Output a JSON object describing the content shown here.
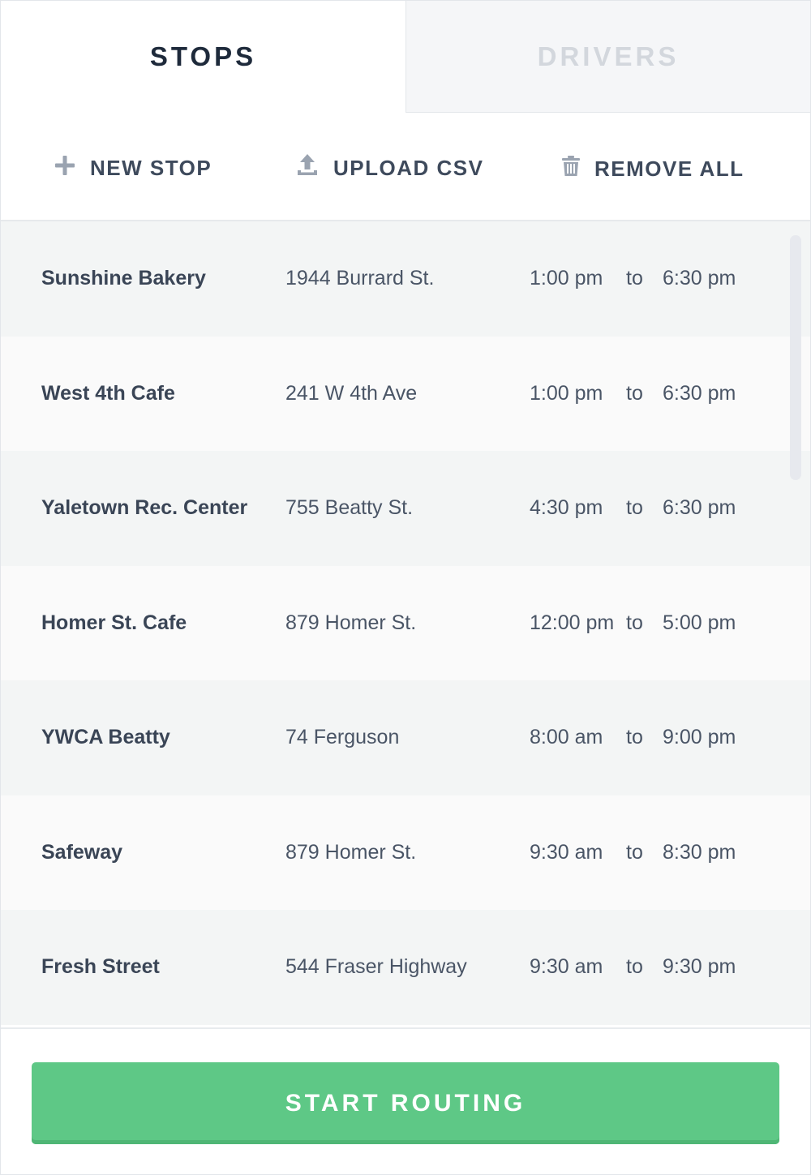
{
  "tabs": [
    {
      "label": "STOPS",
      "active": true
    },
    {
      "label": "DRIVERS",
      "active": false
    }
  ],
  "toolbar": {
    "new_stop": {
      "label": "NEW STOP",
      "icon": "plus-icon"
    },
    "upload_csv": {
      "label": "UPLOAD CSV",
      "icon": "upload-icon"
    },
    "remove_all": {
      "label": "REMOVE ALL",
      "icon": "trash-icon"
    }
  },
  "stops": [
    {
      "name": "Sunshine Bakery",
      "address": "1944 Burrard St.",
      "from": "1:00 pm",
      "sep": "to",
      "until": "6:30 pm"
    },
    {
      "name": "West 4th Cafe",
      "address": "241 W 4th Ave",
      "from": "1:00 pm",
      "sep": "to",
      "until": "6:30 pm"
    },
    {
      "name": "Yaletown Rec. Center",
      "address": "755 Beatty St.",
      "from": "4:30 pm",
      "sep": "to",
      "until": "6:30 pm"
    },
    {
      "name": "Homer St. Cafe",
      "address": "879 Homer St.",
      "from": "12:00 pm",
      "sep": "to",
      "until": "5:00 pm"
    },
    {
      "name": "YWCA Beatty",
      "address": "74 Ferguson",
      "from": "8:00 am",
      "sep": "to",
      "until": "9:00 pm"
    },
    {
      "name": "Safeway",
      "address": "879 Homer St.",
      "from": "9:30 am",
      "sep": "to",
      "until": "8:30 pm"
    },
    {
      "name": "Fresh Street",
      "address": "544 Fraser Highway",
      "from": "9:30 am",
      "sep": "to",
      "until": "9:30 pm"
    }
  ],
  "footer": {
    "start_label": "START ROUTING"
  },
  "colors": {
    "accent": "#5ec886",
    "text": "#3a4556",
    "tab_inactive": "#d3d7dd"
  }
}
